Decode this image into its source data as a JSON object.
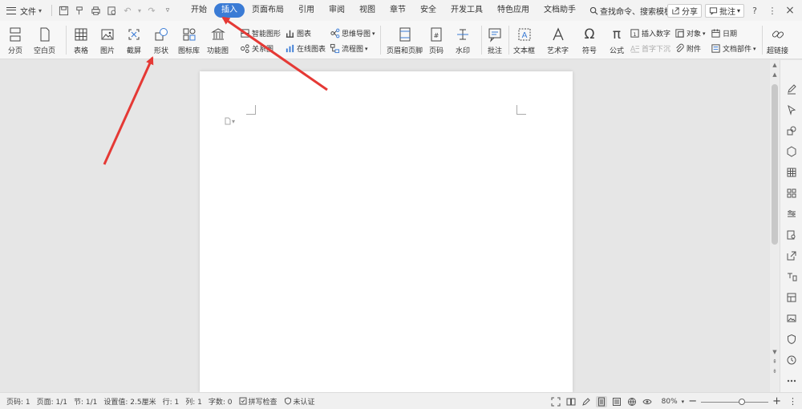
{
  "menubar": {
    "file_label": "文件",
    "tabs": [
      "开始",
      "插入",
      "页面布局",
      "引用",
      "审阅",
      "视图",
      "章节",
      "安全",
      "开发工具",
      "特色应用",
      "文档助手"
    ],
    "active_tab": "插入",
    "search_label": "查找命令、搜索模板",
    "share_label": "分享",
    "comment_label": "批注",
    "help": "?",
    "more": "⋮",
    "close": "×"
  },
  "ribbon": {
    "page_break": "分页",
    "blank_page": "空白页",
    "table": "表格",
    "picture": "图片",
    "screenshot": "截屏",
    "shape": "形状",
    "icon_lib": "图标库",
    "func_chart": "功能图",
    "smart_art": "智能图形",
    "chart": "图表",
    "mind_map": "思维导图",
    "relation_chart": "关系图",
    "online_chart": "在线图表",
    "flowchart": "流程图",
    "header_footer": "页眉和页脚",
    "page_number": "页码",
    "watermark": "水印",
    "comment": "批注",
    "text_box": "文本框",
    "word_art": "艺术字",
    "symbol": "符号",
    "formula": "公式",
    "insert_number": "插入数字",
    "first_char_drop": "首字下沉",
    "object": "对象",
    "attachment": "附件",
    "date": "日期",
    "doc_parts": "文档部件",
    "hyperlink": "超链接"
  },
  "status": {
    "page_code": "页码: 1",
    "page": "页面: 1/1",
    "section": "节: 1/1",
    "setting": "设置值: 2.5厘米",
    "row": "行: 1",
    "col": "列: 1",
    "words": "字数: 0",
    "spell": "拼写检查",
    "cert": "未认证",
    "zoom": "80%",
    "zoom_level": 0.62
  },
  "colors": {
    "accent": "#3a7bd5",
    "arrow": "#e53935"
  }
}
